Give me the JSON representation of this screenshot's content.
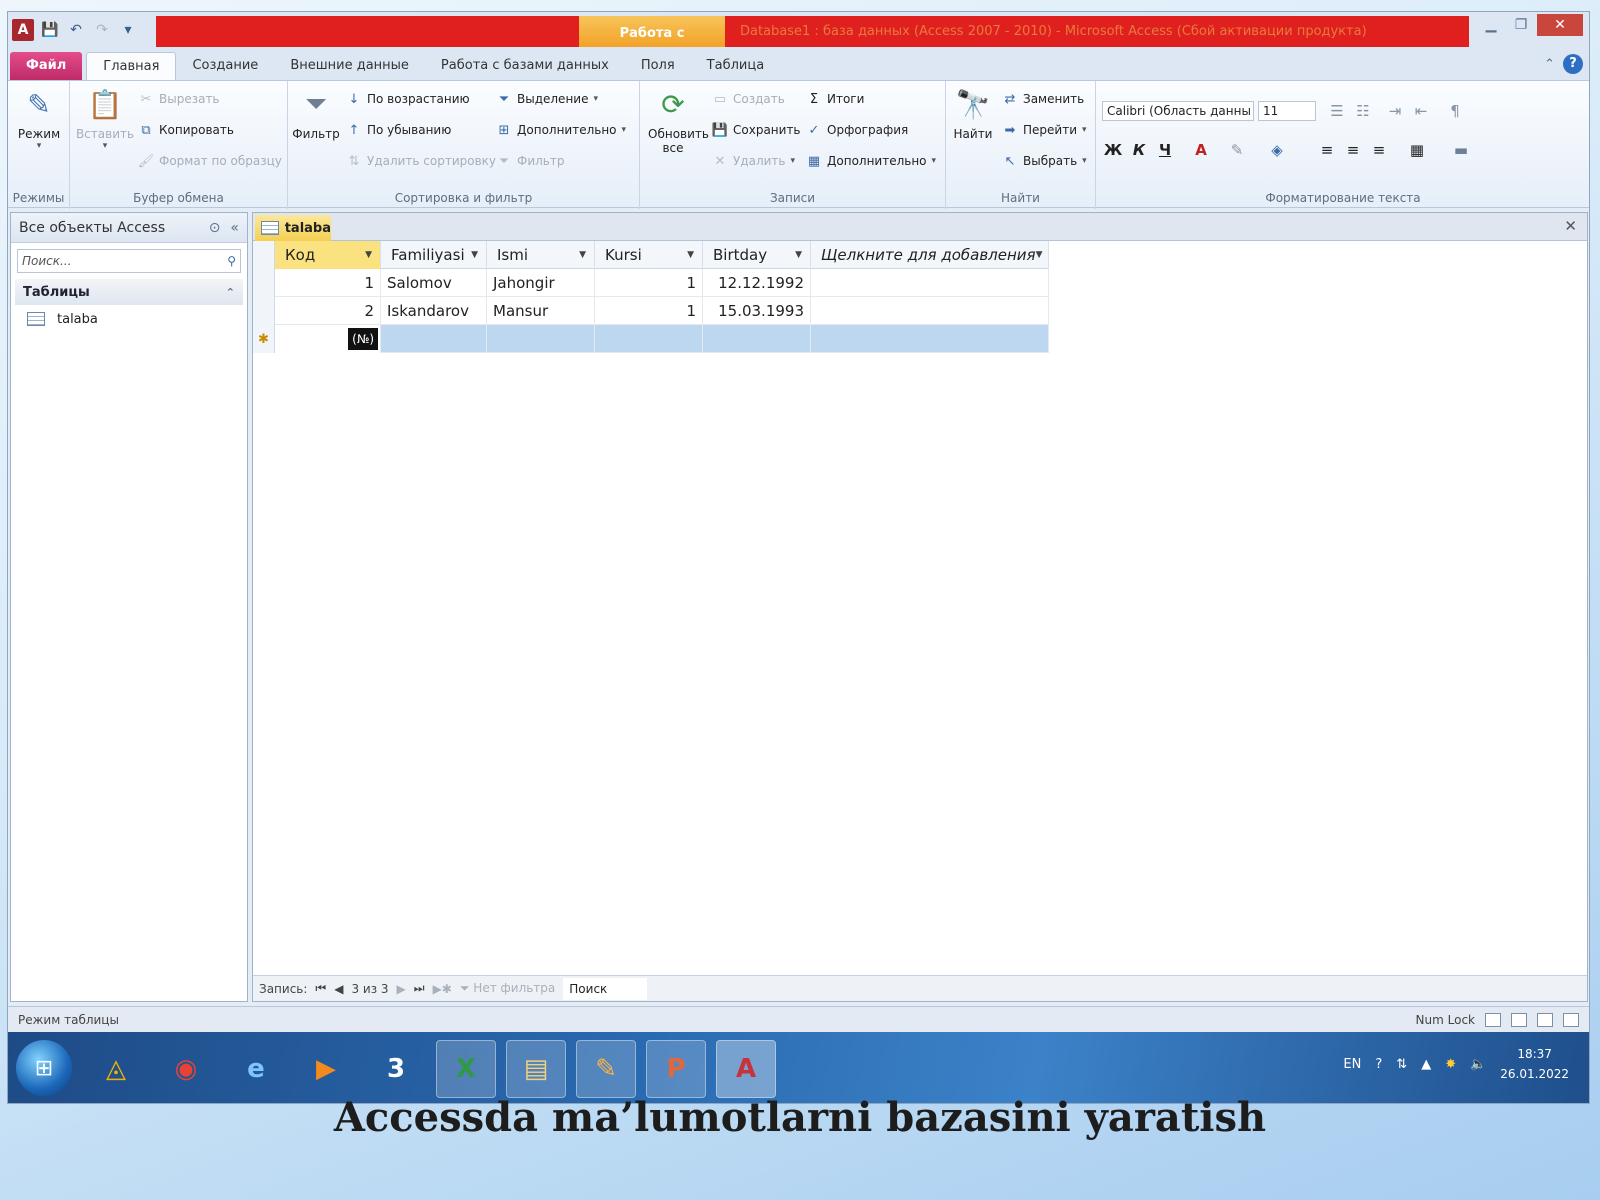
{
  "title": {
    "context_tab": "Работа с таблицами",
    "window_title": "Database1 : база данных (Access 2007 - 2010) - Microsoft Access (Сбой активации продукта)"
  },
  "tabs": [
    "Файл",
    "Главная",
    "Создание",
    "Внешние данные",
    "Работа с базами данных",
    "Поля",
    "Таблица"
  ],
  "ribbon": {
    "views": {
      "mode": "Режим",
      "label": "Режимы"
    },
    "clipboard": {
      "paste": "Вставить",
      "cut": "Вырезать",
      "copy": "Копировать",
      "format_painter": "Формат по образцу",
      "label": "Буфер обмена"
    },
    "sort": {
      "filter": "Фильтр",
      "asc": "По возрастанию",
      "desc": "По убыванию",
      "clear": "Удалить сортировку",
      "selection": "Выделение",
      "advanced": "Дополнительно",
      "toggle": "Фильтр",
      "label": "Сортировка и фильтр"
    },
    "records": {
      "refresh": "Обновить все",
      "create": "Создать",
      "save": "Сохранить",
      "delete": "Удалить",
      "totals": "Итоги",
      "spelling": "Орфография",
      "more": "Дополнительно",
      "label": "Записи"
    },
    "find": {
      "find": "Найти",
      "replace": "Заменить",
      "goto": "Перейти",
      "select": "Выбрать",
      "label": "Найти"
    },
    "text": {
      "font": "Calibri (Область данны",
      "size": "11",
      "bold": "Ж",
      "italic": "К",
      "underline": "Ч",
      "label": "Форматирование текста"
    }
  },
  "nav": {
    "header": "Все объекты Access",
    "search_placeholder": "Поиск...",
    "section": "Таблицы",
    "item": "talaba"
  },
  "doc": {
    "tab": "talaba"
  },
  "table": {
    "columns": [
      "Код",
      "Familiyasi",
      "Ismi",
      "Kursi",
      "Birtday",
      "Щелкните для добавления"
    ],
    "rows": [
      [
        "1",
        "Salomov",
        "Jahongir",
        "1",
        "12.12.1992"
      ],
      [
        "2",
        "Iskandarov",
        "Mansur",
        "1",
        "15.03.1993"
      ]
    ],
    "new_row_badge": "(№)"
  },
  "recnav": {
    "label": "Запись:",
    "position": "3 из 3",
    "filter": "Нет фильтра",
    "search": "Поиск"
  },
  "status": {
    "mode": "Режим таблицы",
    "numlock": "Num Lock"
  },
  "taskbar": {
    "lang": "EN",
    "time": "18:37",
    "date": "26.01.2022"
  },
  "caption": "Accessda ma’lumotlarni bazasini yaratish",
  "colors": {
    "title_red": "#e0201f",
    "context_orange": "#f2a228",
    "file_tab": "#bf2a68",
    "selected_header": "#f9e27f",
    "new_row": "#bdd7f1"
  }
}
